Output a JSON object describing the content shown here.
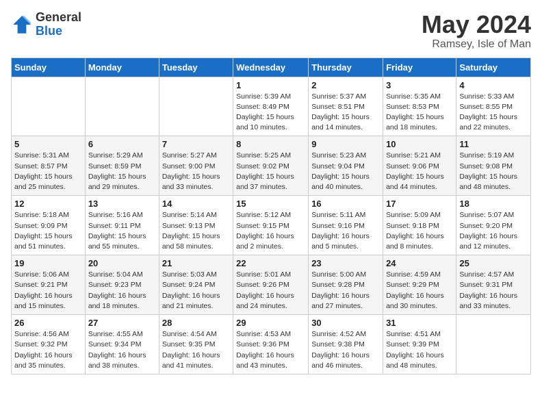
{
  "header": {
    "logo_general": "General",
    "logo_blue": "Blue",
    "month_title": "May 2024",
    "location": "Ramsey, Isle of Man"
  },
  "days_of_week": [
    "Sunday",
    "Monday",
    "Tuesday",
    "Wednesday",
    "Thursday",
    "Friday",
    "Saturday"
  ],
  "weeks": [
    [
      {
        "num": "",
        "info": ""
      },
      {
        "num": "",
        "info": ""
      },
      {
        "num": "",
        "info": ""
      },
      {
        "num": "1",
        "info": "Sunrise: 5:39 AM\nSunset: 8:49 PM\nDaylight: 15 hours\nand 10 minutes."
      },
      {
        "num": "2",
        "info": "Sunrise: 5:37 AM\nSunset: 8:51 PM\nDaylight: 15 hours\nand 14 minutes."
      },
      {
        "num": "3",
        "info": "Sunrise: 5:35 AM\nSunset: 8:53 PM\nDaylight: 15 hours\nand 18 minutes."
      },
      {
        "num": "4",
        "info": "Sunrise: 5:33 AM\nSunset: 8:55 PM\nDaylight: 15 hours\nand 22 minutes."
      }
    ],
    [
      {
        "num": "5",
        "info": "Sunrise: 5:31 AM\nSunset: 8:57 PM\nDaylight: 15 hours\nand 25 minutes."
      },
      {
        "num": "6",
        "info": "Sunrise: 5:29 AM\nSunset: 8:59 PM\nDaylight: 15 hours\nand 29 minutes."
      },
      {
        "num": "7",
        "info": "Sunrise: 5:27 AM\nSunset: 9:00 PM\nDaylight: 15 hours\nand 33 minutes."
      },
      {
        "num": "8",
        "info": "Sunrise: 5:25 AM\nSunset: 9:02 PM\nDaylight: 15 hours\nand 37 minutes."
      },
      {
        "num": "9",
        "info": "Sunrise: 5:23 AM\nSunset: 9:04 PM\nDaylight: 15 hours\nand 40 minutes."
      },
      {
        "num": "10",
        "info": "Sunrise: 5:21 AM\nSunset: 9:06 PM\nDaylight: 15 hours\nand 44 minutes."
      },
      {
        "num": "11",
        "info": "Sunrise: 5:19 AM\nSunset: 9:08 PM\nDaylight: 15 hours\nand 48 minutes."
      }
    ],
    [
      {
        "num": "12",
        "info": "Sunrise: 5:18 AM\nSunset: 9:09 PM\nDaylight: 15 hours\nand 51 minutes."
      },
      {
        "num": "13",
        "info": "Sunrise: 5:16 AM\nSunset: 9:11 PM\nDaylight: 15 hours\nand 55 minutes."
      },
      {
        "num": "14",
        "info": "Sunrise: 5:14 AM\nSunset: 9:13 PM\nDaylight: 15 hours\nand 58 minutes."
      },
      {
        "num": "15",
        "info": "Sunrise: 5:12 AM\nSunset: 9:15 PM\nDaylight: 16 hours\nand 2 minutes."
      },
      {
        "num": "16",
        "info": "Sunrise: 5:11 AM\nSunset: 9:16 PM\nDaylight: 16 hours\nand 5 minutes."
      },
      {
        "num": "17",
        "info": "Sunrise: 5:09 AM\nSunset: 9:18 PM\nDaylight: 16 hours\nand 8 minutes."
      },
      {
        "num": "18",
        "info": "Sunrise: 5:07 AM\nSunset: 9:20 PM\nDaylight: 16 hours\nand 12 minutes."
      }
    ],
    [
      {
        "num": "19",
        "info": "Sunrise: 5:06 AM\nSunset: 9:21 PM\nDaylight: 16 hours\nand 15 minutes."
      },
      {
        "num": "20",
        "info": "Sunrise: 5:04 AM\nSunset: 9:23 PM\nDaylight: 16 hours\nand 18 minutes."
      },
      {
        "num": "21",
        "info": "Sunrise: 5:03 AM\nSunset: 9:24 PM\nDaylight: 16 hours\nand 21 minutes."
      },
      {
        "num": "22",
        "info": "Sunrise: 5:01 AM\nSunset: 9:26 PM\nDaylight: 16 hours\nand 24 minutes."
      },
      {
        "num": "23",
        "info": "Sunrise: 5:00 AM\nSunset: 9:28 PM\nDaylight: 16 hours\nand 27 minutes."
      },
      {
        "num": "24",
        "info": "Sunrise: 4:59 AM\nSunset: 9:29 PM\nDaylight: 16 hours\nand 30 minutes."
      },
      {
        "num": "25",
        "info": "Sunrise: 4:57 AM\nSunset: 9:31 PM\nDaylight: 16 hours\nand 33 minutes."
      }
    ],
    [
      {
        "num": "26",
        "info": "Sunrise: 4:56 AM\nSunset: 9:32 PM\nDaylight: 16 hours\nand 35 minutes."
      },
      {
        "num": "27",
        "info": "Sunrise: 4:55 AM\nSunset: 9:34 PM\nDaylight: 16 hours\nand 38 minutes."
      },
      {
        "num": "28",
        "info": "Sunrise: 4:54 AM\nSunset: 9:35 PM\nDaylight: 16 hours\nand 41 minutes."
      },
      {
        "num": "29",
        "info": "Sunrise: 4:53 AM\nSunset: 9:36 PM\nDaylight: 16 hours\nand 43 minutes."
      },
      {
        "num": "30",
        "info": "Sunrise: 4:52 AM\nSunset: 9:38 PM\nDaylight: 16 hours\nand 46 minutes."
      },
      {
        "num": "31",
        "info": "Sunrise: 4:51 AM\nSunset: 9:39 PM\nDaylight: 16 hours\nand 48 minutes."
      },
      {
        "num": "",
        "info": ""
      }
    ]
  ]
}
